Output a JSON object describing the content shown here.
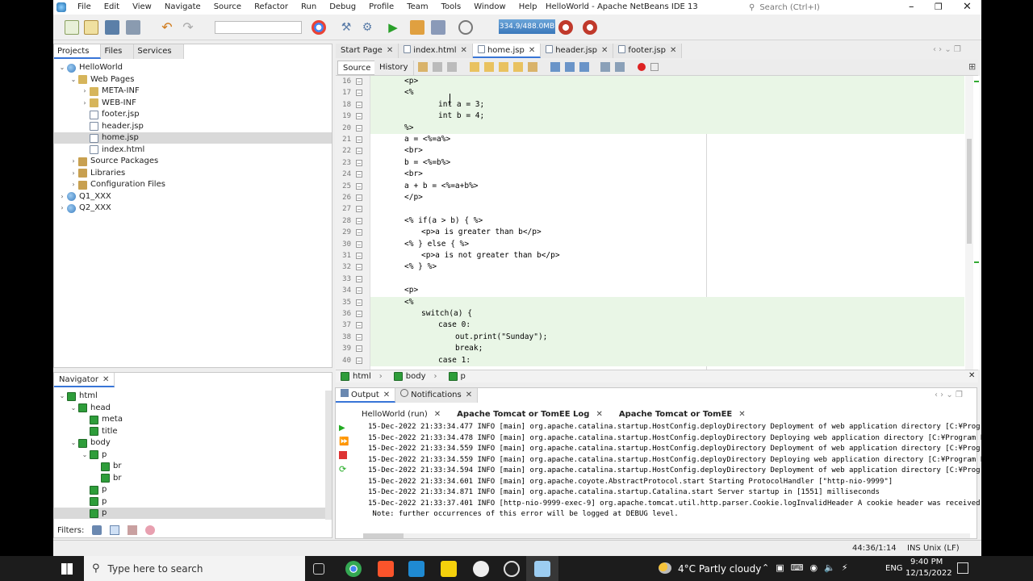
{
  "window": {
    "title": "HelloWorld - Apache NetBeans IDE 13",
    "search_placeholder": "Search (Ctrl+I)",
    "menu": [
      "File",
      "Edit",
      "View",
      "Navigate",
      "Source",
      "Refactor",
      "Run",
      "Debug",
      "Profile",
      "Team",
      "Tools",
      "Window",
      "Help"
    ]
  },
  "toolbar": {
    "memory": "334.9/488.0MB"
  },
  "projects_panel": {
    "tabs": [
      "Projects",
      "Files",
      "Services"
    ],
    "tree": [
      {
        "label": "HelloWorld",
        "depth": 0,
        "icon": "globe",
        "arrow": "down"
      },
      {
        "label": "Web Pages",
        "depth": 1,
        "icon": "folder",
        "arrow": "down"
      },
      {
        "label": "META-INF",
        "depth": 2,
        "icon": "folder",
        "arrow": "right"
      },
      {
        "label": "WEB-INF",
        "depth": 2,
        "icon": "folder",
        "arrow": "right"
      },
      {
        "label": "footer.jsp",
        "depth": 2,
        "icon": "file",
        "arrow": ""
      },
      {
        "label": "header.jsp",
        "depth": 2,
        "icon": "file",
        "arrow": ""
      },
      {
        "label": "home.jsp",
        "depth": 2,
        "icon": "file",
        "arrow": "",
        "selected": true
      },
      {
        "label": "index.html",
        "depth": 2,
        "icon": "file",
        "arrow": ""
      },
      {
        "label": "Source Packages",
        "depth": 1,
        "icon": "pkg",
        "arrow": "right"
      },
      {
        "label": "Libraries",
        "depth": 1,
        "icon": "pkg",
        "arrow": "right"
      },
      {
        "label": "Configuration Files",
        "depth": 1,
        "icon": "pkg",
        "arrow": "right"
      },
      {
        "label": "Q1_XXX",
        "depth": 0,
        "icon": "globe",
        "arrow": "right"
      },
      {
        "label": "Q2_XXX",
        "depth": 0,
        "icon": "globe",
        "arrow": "right"
      }
    ]
  },
  "navigator_panel": {
    "tab": "Navigator",
    "filters_label": "Filters:",
    "tree": [
      {
        "label": "html",
        "depth": 0,
        "arrow": "down"
      },
      {
        "label": "head",
        "depth": 1,
        "arrow": "down"
      },
      {
        "label": "meta",
        "depth": 2,
        "arrow": ""
      },
      {
        "label": "title",
        "depth": 2,
        "arrow": ""
      },
      {
        "label": "body",
        "depth": 1,
        "arrow": "down"
      },
      {
        "label": "p",
        "depth": 2,
        "arrow": "down"
      },
      {
        "label": "br",
        "depth": 3,
        "arrow": ""
      },
      {
        "label": "br",
        "depth": 3,
        "arrow": ""
      },
      {
        "label": "p",
        "depth": 2,
        "arrow": ""
      },
      {
        "label": "p",
        "depth": 2,
        "arrow": ""
      },
      {
        "label": "p",
        "depth": 2,
        "arrow": "",
        "selected": true
      }
    ]
  },
  "editor": {
    "tabs": [
      {
        "label": "Start Page",
        "active": false
      },
      {
        "label": "index.html",
        "active": false
      },
      {
        "label": "home.jsp",
        "active": true
      },
      {
        "label": "header.jsp",
        "active": false
      },
      {
        "label": "footer.jsp",
        "active": false
      }
    ],
    "view_tabs": [
      "Source",
      "History"
    ],
    "lines": [
      {
        "n": "16",
        "text": "<p>",
        "kind": "tag",
        "indent": 0,
        "hl": true
      },
      {
        "n": "17",
        "text": "<%",
        "kind": "jsp",
        "indent": 0,
        "hl": true
      },
      {
        "n": "18",
        "text": "int a = 3;",
        "kind": "java",
        "indent": 2,
        "hl": true
      },
      {
        "n": "19",
        "text": "int b = 4;",
        "kind": "java",
        "indent": 2,
        "hl": true
      },
      {
        "n": "20",
        "text": "%>",
        "kind": "jsp",
        "indent": 0,
        "hl": true
      },
      {
        "n": "21",
        "text": "a = <%=a%>",
        "kind": "mixed",
        "indent": 0,
        "hl": false
      },
      {
        "n": "22",
        "text": "<br>",
        "kind": "tag",
        "indent": 0,
        "hl": false
      },
      {
        "n": "23",
        "text": "b = <%=b%>",
        "kind": "mixed",
        "indent": 0,
        "hl": false
      },
      {
        "n": "24",
        "text": "<br>",
        "kind": "tag",
        "indent": 0,
        "hl": false
      },
      {
        "n": "25",
        "text": "a + b = <%=a+b%>",
        "kind": "mixed",
        "indent": 0,
        "hl": false
      },
      {
        "n": "26",
        "text": "</p>",
        "kind": "tag",
        "indent": 0,
        "hl": false
      },
      {
        "n": "27",
        "text": "",
        "kind": "plain",
        "indent": 0,
        "hl": false
      },
      {
        "n": "28",
        "text": "<% if(a > b) { %>",
        "kind": "jsp",
        "indent": 0,
        "hl": false
      },
      {
        "n": "29",
        "text": "<p>a is greater than b</p>",
        "kind": "mixed",
        "indent": 1,
        "hl": false
      },
      {
        "n": "30",
        "text": "<% } else { %>",
        "kind": "jsp",
        "indent": 0,
        "hl": false
      },
      {
        "n": "31",
        "text": "<p>a is not greater than b</p>",
        "kind": "mixed",
        "indent": 1,
        "hl": false
      },
      {
        "n": "32",
        "text": "<% } %>",
        "kind": "jsp",
        "indent": 0,
        "hl": false
      },
      {
        "n": "33",
        "text": "",
        "kind": "plain",
        "indent": 0,
        "hl": false
      },
      {
        "n": "34",
        "text": "<p>",
        "kind": "tag",
        "indent": 0,
        "hl": false
      },
      {
        "n": "35",
        "text": "<%",
        "kind": "jsp",
        "indent": 0,
        "hl": true
      },
      {
        "n": "36",
        "text": "switch(a) {",
        "kind": "java",
        "indent": 1,
        "hl": true
      },
      {
        "n": "37",
        "text": "case 0:",
        "kind": "java",
        "indent": 2,
        "hl": true
      },
      {
        "n": "38",
        "text": "out.print(\"Sunday\");",
        "kind": "java",
        "indent": 3,
        "hl": true
      },
      {
        "n": "39",
        "text": "break;",
        "kind": "java",
        "indent": 3,
        "hl": true
      },
      {
        "n": "40",
        "text": "case 1:",
        "kind": "java",
        "indent": 2,
        "hl": true
      }
    ],
    "breadcrumbs": [
      "html",
      "body",
      "p"
    ]
  },
  "output": {
    "tabs": [
      "Output",
      "Notifications"
    ],
    "subtabs": [
      {
        "label": "HelloWorld (run)",
        "bold": false
      },
      {
        "label": "Apache Tomcat or TomEE Log",
        "bold": true
      },
      {
        "label": "Apache Tomcat or TomEE",
        "bold": true
      }
    ],
    "lines": [
      "15-Dec-2022 21:33:34.477 INFO [main] org.apache.catalina.startup.HostConfig.deployDirectory Deployment of web application directory [C:¥Program Files¥Apache",
      "15-Dec-2022 21:33:34.478 INFO [main] org.apache.catalina.startup.HostConfig.deployDirectory Deploying web application directory [C:¥Program Files¥Apache Soft",
      "15-Dec-2022 21:33:34.559 INFO [main] org.apache.catalina.startup.HostConfig.deployDirectory Deployment of web application directory [C:¥Program Files¥Apache",
      "15-Dec-2022 21:33:34.559 INFO [main] org.apache.catalina.startup.HostConfig.deployDirectory Deploying web application directory [C:¥Program Files¥Apache Soft",
      "15-Dec-2022 21:33:34.594 INFO [main] org.apache.catalina.startup.HostConfig.deployDirectory Deployment of web application directory [C:¥Program Files¥Apache",
      "15-Dec-2022 21:33:34.601 INFO [main] org.apache.coyote.AbstractProtocol.start Starting ProtocolHandler [\"http-nio-9999\"]",
      "15-Dec-2022 21:33:34.871 INFO [main] org.apache.catalina.startup.Catalina.start Server startup in [1551] milliseconds",
      "15-Dec-2022 21:33:37.401 INFO [http-nio-9999-exec-9] org.apache.tomcat.util.http.parser.Cookie.logInvalidHeader A cookie header was received [g_state={\"i_l\":",
      " Note: further occurrences of this error will be logged at DEBUG level."
    ]
  },
  "statusbar": {
    "position": "44:36/1:14",
    "mode": "INS",
    "line_ending": "Unix (LF)"
  },
  "taskbar": {
    "search_placeholder": "Type here to search",
    "weather": "4°C  Partly cloudy",
    "lang": "ENG",
    "time": "9:40 PM",
    "date": "12/15/2022"
  }
}
